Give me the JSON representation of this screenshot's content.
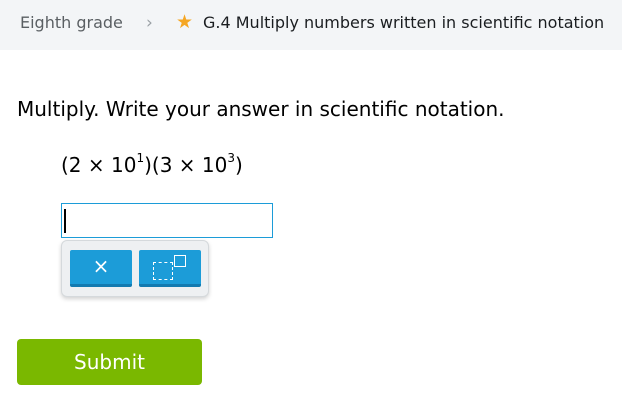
{
  "breadcrumb": {
    "grade": "Eighth grade",
    "separator": "›",
    "skill": "G.4 Multiply numbers written in scientific notation"
  },
  "question": {
    "instruction": "Multiply. Write your answer in scientific notation.",
    "expression": {
      "open1": "(2 × 10",
      "exp1": "1",
      "mid": ")(3 × 10",
      "exp2": "3",
      "close": ")"
    }
  },
  "answer": {
    "value": ""
  },
  "keypad": {
    "times_label": "×"
  },
  "submit_label": "Submit",
  "colors": {
    "accent_blue": "#1c9cd8",
    "submit_green": "#7ab800",
    "star_gold": "#f5a623"
  }
}
